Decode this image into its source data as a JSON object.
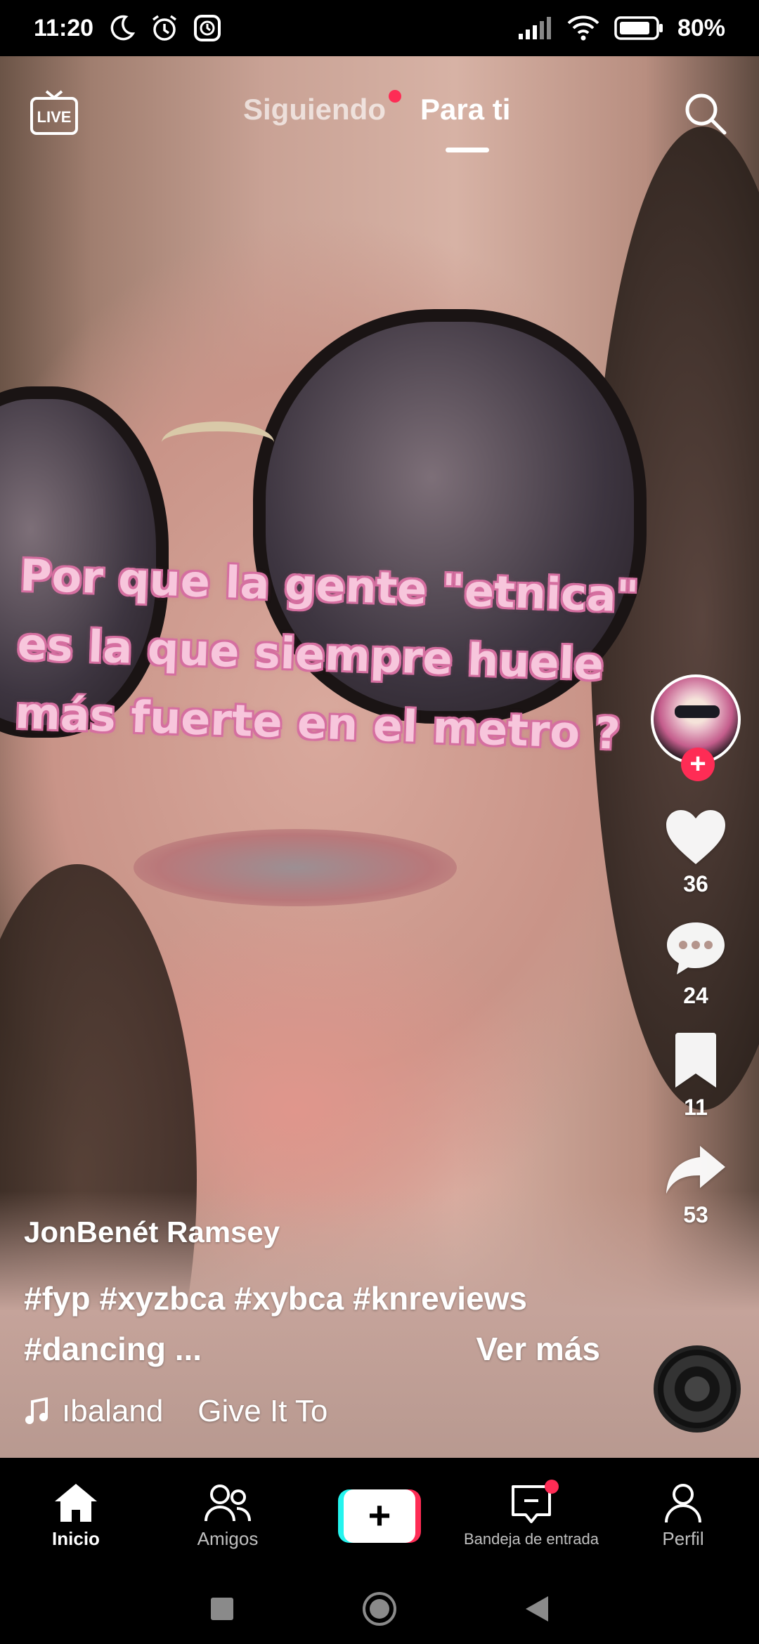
{
  "status_bar": {
    "time": "11:20",
    "battery": "80%",
    "icons": [
      "moon-icon",
      "alarm-icon",
      "app-notification-icon",
      "signal-icon",
      "wifi-icon",
      "battery-icon"
    ]
  },
  "top_nav": {
    "live_label": "LIVE",
    "tabs": [
      {
        "label": "Siguiendo",
        "has_dot": true
      },
      {
        "label": "Para ti",
        "active": true
      }
    ]
  },
  "video": {
    "overlay_lines": [
      "Por que la gente \"etnica\"",
      "es la que siempre huele",
      "más fuerte en el metro ?"
    ]
  },
  "actions": {
    "likes": "36",
    "comments": "24",
    "saves": "11",
    "shares": "53"
  },
  "caption": {
    "author": "JonBenét Ramsey",
    "hashtags_line1": "#fyp #xyzbca #xybca #knreviews",
    "hashtags_line2": "#dancing ...",
    "see_more": "Ver más",
    "music": "ıbaland    Give It To",
    "music_icon": "music-note-icon"
  },
  "bottom_nav": {
    "items": [
      {
        "label": "Inicio",
        "active": true
      },
      {
        "label": "Amigos"
      },
      {
        "label": "+"
      },
      {
        "label": "Bandeja de entrada",
        "has_dot": true
      },
      {
        "label": "Perfil"
      }
    ]
  },
  "colors": {
    "accent": "#fe2c55",
    "cyan": "#25f4ee",
    "overlay_text": "#f7c6dc"
  }
}
